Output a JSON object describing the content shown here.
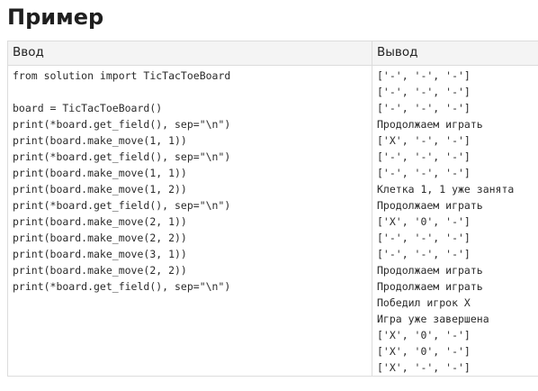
{
  "page": {
    "title": "Пример"
  },
  "table": {
    "headers": {
      "input": "Ввод",
      "output": "Вывод"
    },
    "input_lines": [
      "from solution import TicTacToeBoard",
      "",
      "board = TicTacToeBoard()",
      "print(*board.get_field(), sep=\"\\n\")",
      "print(board.make_move(1, 1))",
      "print(*board.get_field(), sep=\"\\n\")",
      "print(board.make_move(1, 1))",
      "print(board.make_move(1, 2))",
      "print(*board.get_field(), sep=\"\\n\")",
      "print(board.make_move(2, 1))",
      "print(board.make_move(2, 2))",
      "print(board.make_move(3, 1))",
      "print(board.make_move(2, 2))",
      "print(*board.get_field(), sep=\"\\n\")"
    ],
    "output_lines": [
      "['-', '-', '-']",
      "['-', '-', '-']",
      "['-', '-', '-']",
      "Продолжаем играть",
      "['X', '-', '-']",
      "['-', '-', '-']",
      "['-', '-', '-']",
      "Клетка 1, 1 уже занята",
      "Продолжаем играть",
      "['X', '0', '-']",
      "['-', '-', '-']",
      "['-', '-', '-']",
      "Продолжаем играть",
      "Продолжаем играть",
      "Победил игрок X",
      "Игра уже завершена",
      "['X', '0', '-']",
      "['X', '0', '-']",
      "['X', '-', '-']"
    ]
  }
}
